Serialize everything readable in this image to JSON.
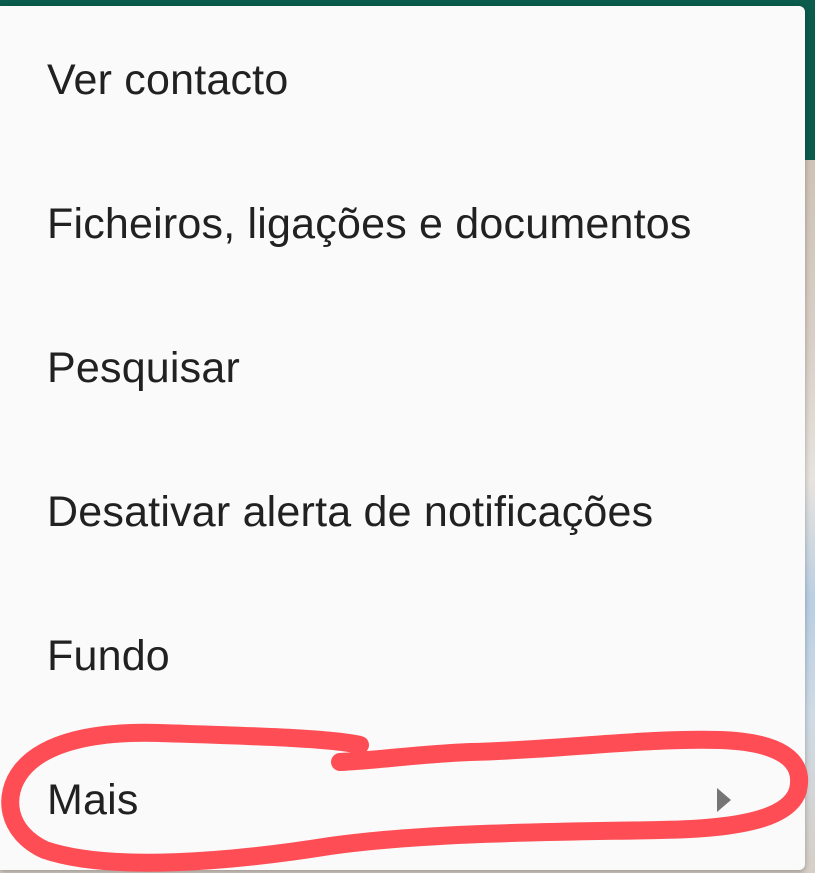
{
  "menu": {
    "items": [
      {
        "label": "Ver contacto"
      },
      {
        "label": "Ficheiros, ligações e documentos"
      },
      {
        "label": "Pesquisar"
      },
      {
        "label": "Desativar alerta de notificações"
      },
      {
        "label": "Fundo"
      },
      {
        "label": "Mais",
        "icon": "submenu-arrow-icon"
      }
    ]
  },
  "colors": {
    "app_bar": "#0b5c4d",
    "menu_background": "#fafafa",
    "menu_text": "#212121",
    "annotation": "#ff4d55"
  }
}
